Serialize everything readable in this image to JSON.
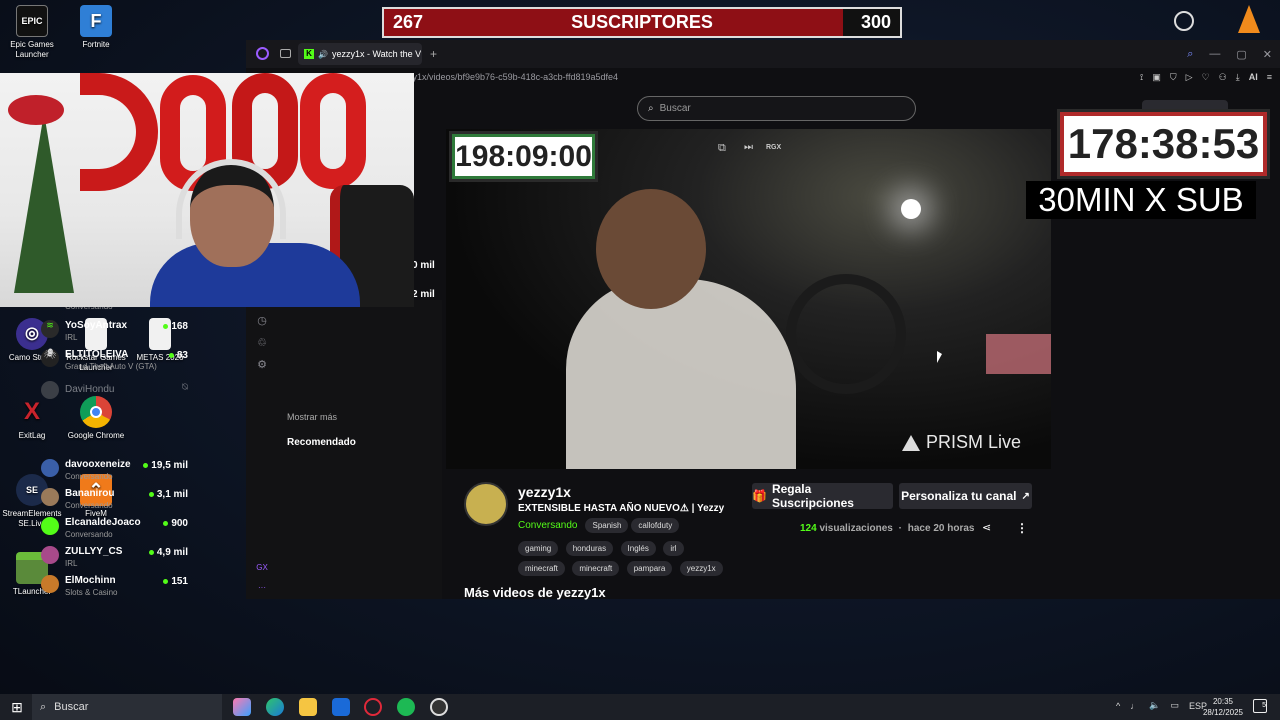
{
  "desktop_icons": [
    {
      "label": "Epic Games Launcher",
      "glyph": "EPIC",
      "color": "#111"
    },
    {
      "label": "Fortnite",
      "glyph": "F",
      "color": "#2f7fd6"
    },
    {
      "label": "Camo Studio",
      "glyph": "◎",
      "color": "#3b2f8f"
    },
    {
      "label": "Rockstar Games Launcher",
      "glyph": "",
      "color": "#f1f1f1"
    },
    {
      "label": "METAS 2026",
      "glyph": "",
      "color": "#f1f1f1"
    },
    {
      "label": "ExitLag",
      "glyph": "X",
      "color": "#c8232c"
    },
    {
      "label": "Google Chrome",
      "glyph": "●",
      "color": "#e8e8e8"
    },
    {
      "label": "StreamElements SE.Live",
      "glyph": "SE",
      "color": "#1b2a4a"
    },
    {
      "label": "FiveM",
      "glyph": "⌃",
      "color": "#f07a1a"
    },
    {
      "label": "TLauncher",
      "glyph": "■",
      "color": "#5a8a3a"
    }
  ],
  "sub_goal": {
    "current": "267",
    "label": "SUSCRIPTORES",
    "target": "300",
    "progress": 0.89
  },
  "browser": {
    "tab_title": "yezzy1x - Watch the V",
    "url": "yezzy1x/videos/bf9e9b76-c59b-418c-a3cb-ffd819a5dfe4",
    "search_placeholder": "Buscar",
    "ai_label": "AI"
  },
  "sidebar": {
    "partial_counts": [
      "0 mil",
      "2 mil"
    ],
    "following": [
      {
        "name": "",
        "sub": "Conversando",
        "count": ""
      },
      {
        "name": "YoSoyAntrax",
        "sub": "IRL",
        "count": "168"
      },
      {
        "name": "ELTITOLEIVA",
        "sub": "Grand Theft Auto V (GTA)",
        "count": "83"
      },
      {
        "name": "DaviHondu",
        "sub": "",
        "count": ""
      }
    ],
    "show_more": "Mostrar más",
    "recommended_title": "Recomendado",
    "recommended": [
      {
        "name": "davooxeneize",
        "sub": "Conversando",
        "count": "19,5 mil",
        "color": "#3a5fa8"
      },
      {
        "name": "Bananirou",
        "sub": "Conversando",
        "count": "3,1 mil",
        "color": "#9a7a5a"
      },
      {
        "name": "ElcanaldeJoaco",
        "sub": "Conversando",
        "count": "900",
        "color": "#53fc18"
      },
      {
        "name": "ZULLYY_CS",
        "sub": "IRL",
        "count": "4,9 mil",
        "color": "#a84a8a"
      },
      {
        "name": "ElMochinn",
        "sub": "Slots & Casino",
        "count": "151",
        "color": "#c87a2a"
      }
    ]
  },
  "overlays": {
    "timer_left": "198:09:00",
    "timer_right": "178:38:53",
    "sub_rule": "30MIN X SUB",
    "watermark": "PRISM Live",
    "rgx": "RGX"
  },
  "video_info": {
    "channel": "yezzy1x",
    "title": "EXTENSIBLE HASTA AÑO NUEVO⚠ | Yezzy",
    "category": "Conversando",
    "tags_row1": [
      "Spanish",
      "callofduty"
    ],
    "tags_row2": [
      "gaming",
      "honduras",
      "Inglés",
      "irl"
    ],
    "tags_row3": [
      "minecraft",
      "minecraft",
      "pampara",
      "yezzy1x"
    ],
    "gift_button": "Regala Suscripciones",
    "customize_button": "Personaliza tu canal",
    "views_count": "124",
    "views_label": "visualizaciones",
    "time_ago": "hace 20 horas",
    "more_videos": "Más videos de yezzy1x"
  },
  "taskbar": {
    "search": "Buscar",
    "lang": "ESP",
    "time": "20:35",
    "date": "28/12/2025",
    "notif": "5"
  },
  "colors": {
    "kick_green": "#53fc18",
    "sub_red": "#8e0f15",
    "accent_purple": "#9b5cff"
  }
}
